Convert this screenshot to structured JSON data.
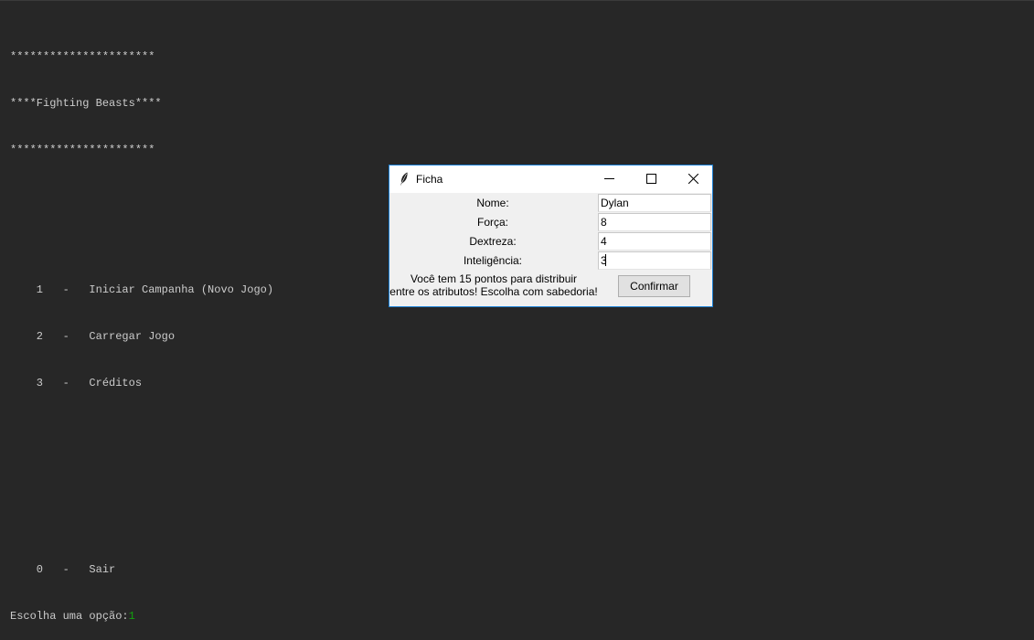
{
  "console": {
    "lines": [
      "**********************",
      "****Fighting Beasts****",
      "**********************",
      "",
      "",
      "    1   -   Iniciar Campanha (Novo Jogo)",
      "    2   -   Carregar Jogo",
      "    3   -   Créditos",
      "",
      "",
      "",
      "    0   -   Sair"
    ],
    "prompt": "Escolha uma opção:",
    "input_value": "1"
  },
  "window": {
    "title": "Ficha",
    "icon": "feather-icon",
    "fields": [
      {
        "label": "Nome:",
        "value": "Dylan"
      },
      {
        "label": "Força:",
        "value": "8"
      },
      {
        "label": "Dextreza:",
        "value": "4"
      },
      {
        "label": "Inteligência:",
        "value": "3"
      }
    ],
    "message_line1": "Você tem 15 pontos para distribuir",
    "message_line2": "entre os atributos! Escolha com sabedoria!",
    "confirm_label": "Confirmar"
  },
  "colors": {
    "console_bg": "#272727",
    "console_text": "#cccccc",
    "console_input": "#13a10e",
    "window_border": "#1a7fd4"
  }
}
